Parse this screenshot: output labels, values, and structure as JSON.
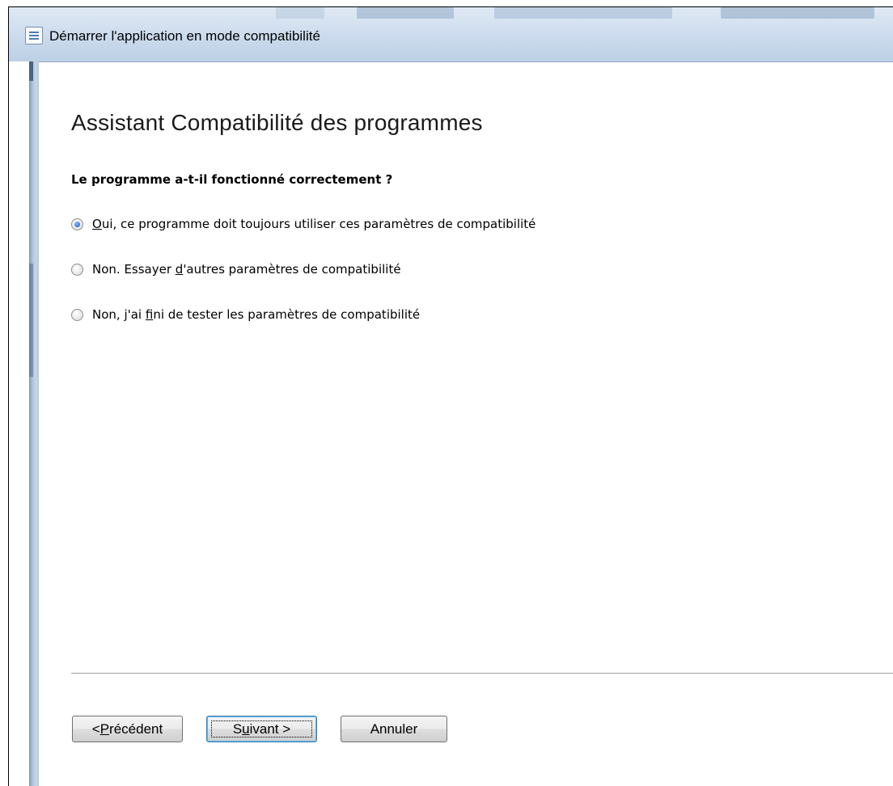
{
  "window": {
    "title": "Démarrer l'application en mode compatibilité"
  },
  "wizard": {
    "heading": "Assistant Compatibilité des programmes",
    "question": "Le programme a-t-il fonctionné correctement ?",
    "options": [
      {
        "pre": "",
        "mnemonic": "O",
        "post": "ui, ce programme doit toujours utiliser ces paramètres de compatibilité",
        "checked": true
      },
      {
        "pre": "Non. Essayer ",
        "mnemonic": "d",
        "post": "'autres paramètres de compatibilité",
        "checked": false
      },
      {
        "pre": "Non, j'ai ",
        "mnemonic": "f",
        "post": "ini de tester les paramètres de compatibilité",
        "checked": false
      }
    ]
  },
  "buttons": {
    "back": {
      "pre": "< ",
      "mnemonic": "P",
      "post": "récédent"
    },
    "next": {
      "pre": "S",
      "mnemonic": "u",
      "post": "ivant >"
    },
    "cancel": {
      "label": "Annuler"
    }
  },
  "icons": {
    "title_icon": "window-list-icon"
  },
  "colors": {
    "title_bar": "#cfdeef",
    "radio_selected": "#2f6fd6",
    "default_button_border": "#3c7fb1"
  }
}
